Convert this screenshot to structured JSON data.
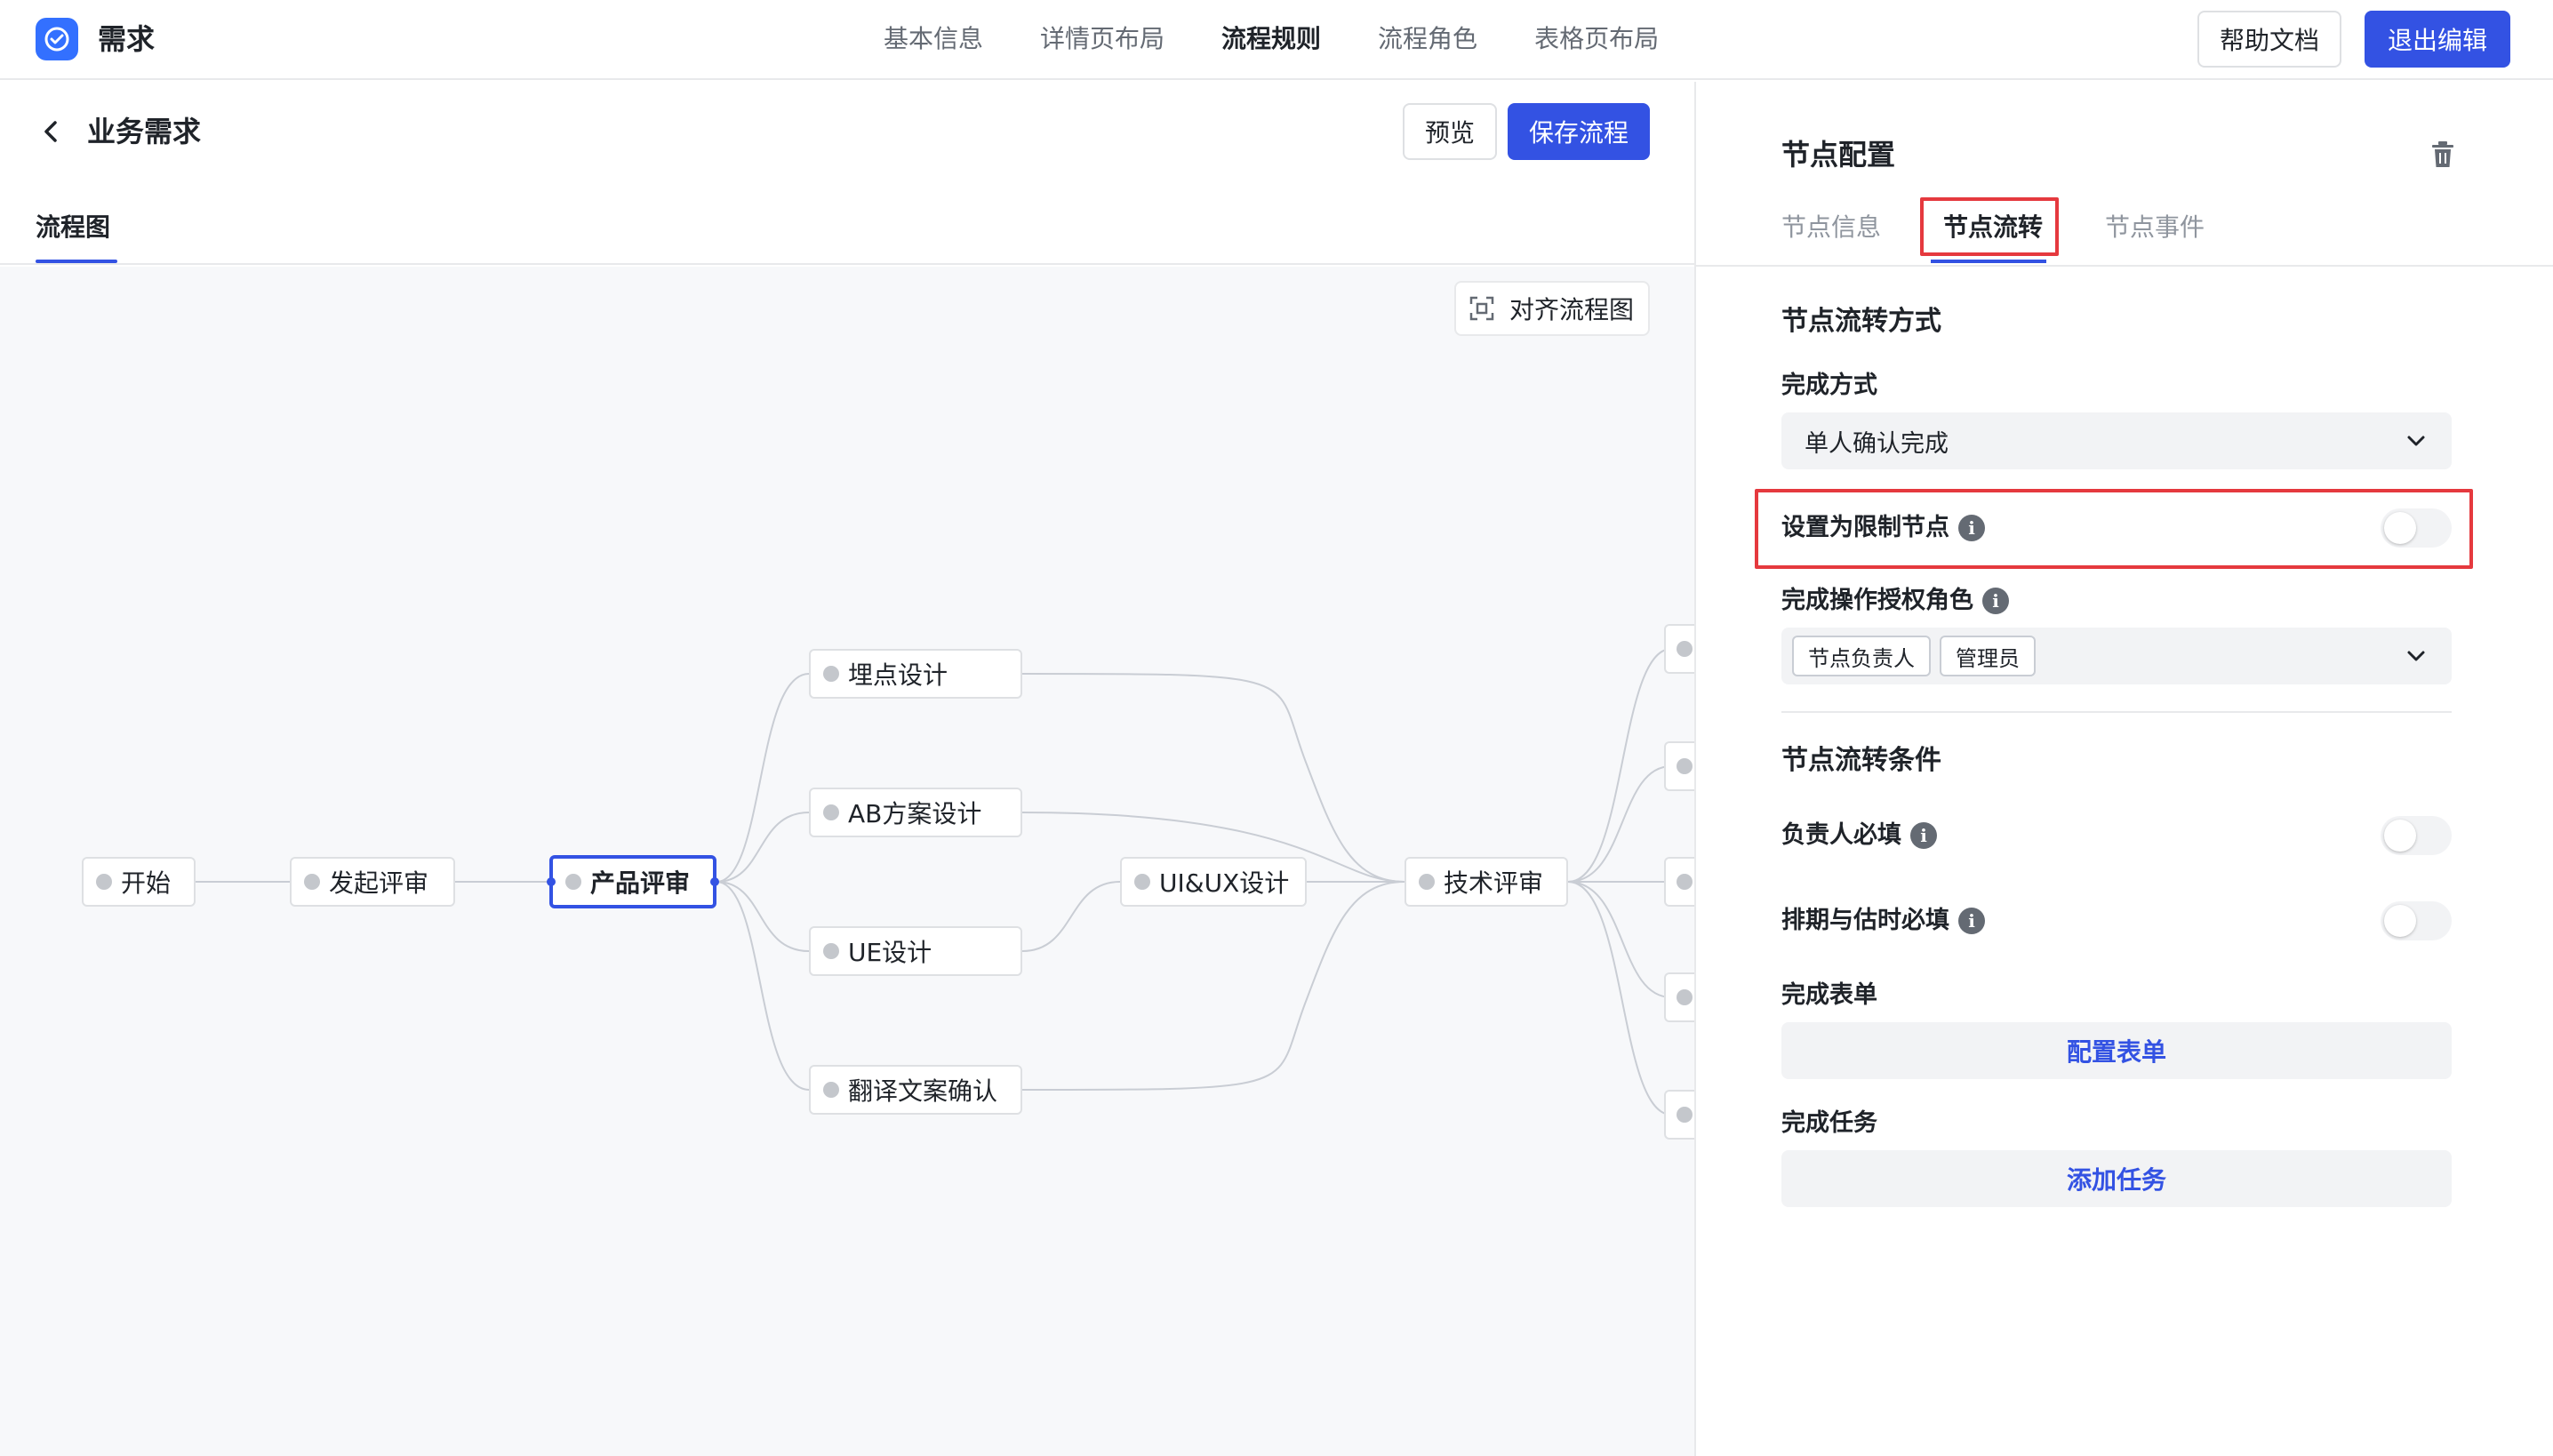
{
  "app": {
    "title": "需求",
    "logo_icon": "check-circle-icon",
    "brand_color": "#3370ff"
  },
  "nav": {
    "tabs": [
      "基本信息",
      "详情页布局",
      "流程规则",
      "流程角色",
      "表格页布局"
    ],
    "active_tab": "流程规则",
    "help_button": "帮助文档",
    "exit_button": "退出编辑"
  },
  "page": {
    "title": "业务需求",
    "preview_button": "预览",
    "save_button": "保存流程",
    "sub_tab": "流程图"
  },
  "canvas": {
    "align_button": "对齐流程图",
    "nodes": {
      "start": "开始",
      "initiate_review": "发起评审",
      "product_review": "产品评审",
      "tracking_design": "埋点设计",
      "ab_design": "AB方案设计",
      "ue_design": "UE设计",
      "translation_confirm": "翻译文案确认",
      "ui_ux_design": "UI&UX设计",
      "tech_review": "技术评审"
    },
    "selected_node": "产品评审"
  },
  "panel": {
    "title": "节点配置",
    "tabs": [
      "节点信息",
      "节点流转",
      "节点事件"
    ],
    "active_tab": "节点流转",
    "flow_method": {
      "title": "节点流转方式",
      "completion_label": "完成方式",
      "completion_value": "单人确认完成",
      "restrict_label": "设置为限制节点",
      "restrict_on": false,
      "roles_label": "完成操作授权角色",
      "roles": [
        "节点负责人",
        "管理员"
      ]
    },
    "flow_conditions": {
      "title": "节点流转条件",
      "owner_required_label": "负责人必填",
      "owner_required_on": false,
      "schedule_required_label": "排期与估时必填",
      "schedule_required_on": false,
      "form_label": "完成表单",
      "form_button": "配置表单",
      "task_label": "完成任务",
      "task_button": "添加任务"
    }
  },
  "colors": {
    "primary": "#3352e3",
    "highlight": "#e5393e"
  }
}
